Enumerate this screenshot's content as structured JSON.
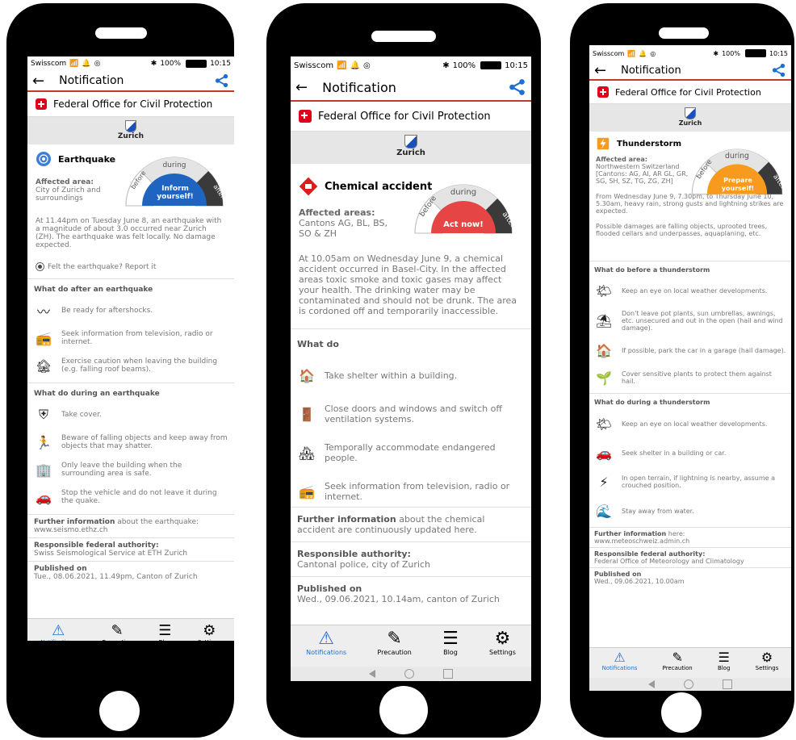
{
  "status": {
    "carrier": "Swisscom",
    "battery": "100%",
    "time": "10:15"
  },
  "appbar": {
    "title": "Notification"
  },
  "office": {
    "name": "Federal Office for Civil Protection"
  },
  "canton": {
    "name": "Zurich"
  },
  "gauge_labels": {
    "before": "before",
    "during": "during",
    "after": "after"
  },
  "tabs": {
    "notifications": "Notifications",
    "precaution": "Precaution",
    "blog": "Blog",
    "settings": "Settings"
  },
  "colors": {
    "accent": "#1e6fd0",
    "alert_red": "#c0392b",
    "inform_blue": "#1f64c0",
    "act_red": "#e64545",
    "prepare_orange": "#f79a1e"
  },
  "phones": [
    {
      "event": {
        "title": "Earthquake",
        "affected_label": "Affected area:",
        "affected_value": "City of Zurich and surroundings",
        "stage_label": "Inform yourself!",
        "description": "At 11.44pm on Tuesday June 8, an earthquake with a magnitude of about 3.0 occurred near Zurich (ZH). The earthquake was felt locally. No damage expected.",
        "report_link": "Felt the earthquake? Report it"
      },
      "sections": [
        {
          "title": "What do after an earthquake",
          "items": [
            "Be ready for aftershocks.",
            "Seek information from television, radio or internet.",
            "Exercise caution when leaving the building (e.g. falling roof beams)."
          ]
        },
        {
          "title": "What do during an earthquake",
          "items": [
            "Take cover.",
            "Beware of falling objects and keep away from objects that may shatter.",
            "Only leave the building when the surrounding area is safe.",
            "Stop the vehicle and do not leave it during the quake."
          ]
        }
      ],
      "further": {
        "label": "Further information",
        "text": " about the earthquake:",
        "link": "www.seismo.ethz.ch"
      },
      "authority": {
        "label": "Responsible federal authority:",
        "value": "Swiss Seismological Service at ETH Zurich"
      },
      "published": {
        "label": "Published on",
        "value": "Tue., 08.06.2021, 11.49pm, Canton of Zurich"
      }
    },
    {
      "event": {
        "title": "Chemical accident",
        "affected_label": "Affected areas:",
        "affected_value": "Cantons AG, BL, BS, SO & ZH",
        "stage_label": "Act now!",
        "description": "At 10.05am on Wednesday June 9, a chemical accident occurred in Basel-City. In the affected areas toxic smoke and toxic gases may affect your health. The drinking water may be contaminated and should not be drunk. The area is cordoned off and temporarily inaccessible."
      },
      "sections": [
        {
          "title": "What do",
          "items": [
            "Take shelter within a building.",
            "Close doors and windows and switch off ventilation systems.",
            "Temporally accommodate endangered people.",
            "Seek information from television, radio or internet."
          ]
        }
      ],
      "further": {
        "label": "Further information",
        "text": " about the chemical accident are continuously updated here."
      },
      "authority": {
        "label": "Responsible authority:",
        "value": "Cantonal police, city of Zurich"
      },
      "published": {
        "label": "Published on",
        "value": "Wed., 09.06.2021, 10.14am, canton of Zurich"
      }
    },
    {
      "event": {
        "title": "Thunderstorm",
        "affected_label": "Affected area:",
        "affected_value": "Northwestern Switzerland [Cantons: AG, AI, AR GL, GR, SG, SH, SZ, TG, ZG, ZH]",
        "stage_label": "Prepare yourself!",
        "description": "From Wednesday June 9, 7.30pm, to Thursday June 10, 5.30am, heavy rain, strong gusts and lightning strikes are expected.",
        "description2": "Possible damages are falling objects, uprooted trees, flooded cellars and underpasses, aquaplaning, etc."
      },
      "sections": [
        {
          "title": "What do before a thunderstorm",
          "items": [
            "Keep an eye on local weather developments.",
            "Don't leave pot plants, sun umbrellas, awnings, etc. unsecured and out in the open (hail and wind damage).",
            "If possible, park the car in a garage (hail damage).",
            "Cover sensitive plants to protect them against hail."
          ]
        },
        {
          "title": "What do during a thunderstorm",
          "items": [
            "Keep an eye on local weather developments.",
            "Seek shelter in a building or car.",
            "In open terrain, if lightning is nearby, assume a crouched position.",
            "Stay away from water."
          ]
        }
      ],
      "further": {
        "label": "Further information",
        "text": " here:",
        "link": "www.meteoschweiz.admin.ch"
      },
      "authority": {
        "label": "Responsible federal authority:",
        "value": "Federal Office of Meteorology and Climatology"
      },
      "published": {
        "label": "Published on",
        "value": "Wed., 09.06.2021, 10.00am"
      }
    }
  ]
}
